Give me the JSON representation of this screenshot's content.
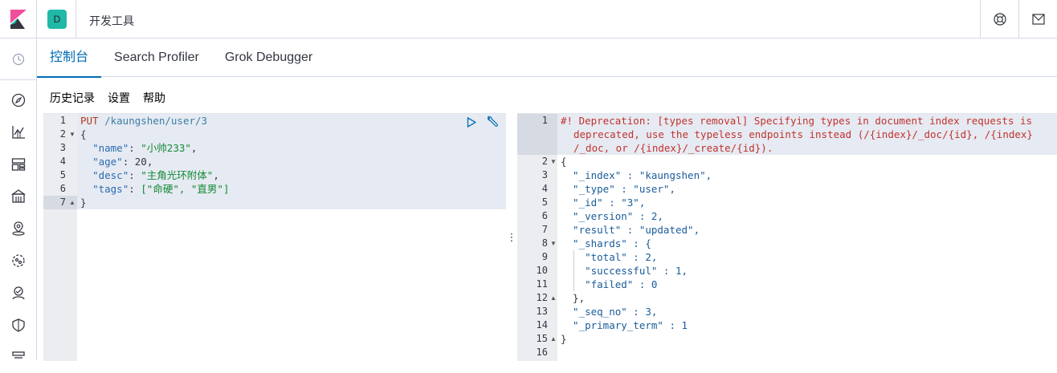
{
  "header": {
    "space_initial": "D",
    "app_title": "开发工具"
  },
  "icons": {
    "logo": "kibana-logo-icon",
    "help": "help-lifebuoy-icon",
    "mail": "mail-icon",
    "recent": "clock-icon",
    "nav": [
      "compass-icon",
      "visualize-icon",
      "dashboard-icon",
      "canvas-icon",
      "maps-icon",
      "ml-icon",
      "apm-icon",
      "siem-icon",
      "logs-icon"
    ]
  },
  "tabs": [
    {
      "label": "控制台",
      "active": true
    },
    {
      "label": "Search Profiler",
      "active": false
    },
    {
      "label": "Grok Debugger",
      "active": false
    }
  ],
  "submenu": {
    "history": "历史记录",
    "settings": "设置",
    "help": "帮助"
  },
  "request": {
    "line_numbers": [
      "1",
      "2",
      "3",
      "4",
      "5",
      "6",
      "7"
    ],
    "method": "PUT",
    "url": "/kaungshen/user/3",
    "lines": [
      {
        "key": "\"name\"",
        "val": "\"小帅233\"",
        "trail": ","
      },
      {
        "key": "\"age\"",
        "val": "20",
        "trail": ","
      },
      {
        "key": "\"desc\"",
        "val": "\"主角光环附体\"",
        "trail": ","
      },
      {
        "key": "\"tags\"",
        "val": "[\"命硬\", \"直男\"]",
        "trail": ""
      }
    ],
    "open_brace": "{",
    "close_brace": "}"
  },
  "response": {
    "line_numbers": [
      "1",
      "2",
      "3",
      "4",
      "5",
      "6",
      "7",
      "8",
      "9",
      "10",
      "11",
      "12",
      "13",
      "14",
      "15",
      "16"
    ],
    "warning": [
      "#! Deprecation: [types removal] Specifying types in document index requests is",
      "deprecated, use the typeless endpoints instead (/{index}/_doc/{id}, /{index}",
      "/_doc, or /{index}/_create/{id})."
    ],
    "body": [
      "{",
      "  \"_index\" : \"kaungshen\",",
      "  \"_type\" : \"user\",",
      "  \"_id\" : \"3\",",
      "  \"_version\" : 2,",
      "  \"result\" : \"updated\",",
      "  \"_shards\" : {",
      "    \"total\" : 2,",
      "    \"successful\" : 1,",
      "    \"failed\" : 0",
      "  },",
      "  \"_seq_no\" : 3,",
      "  \"_primary_term\" : 1",
      "}"
    ]
  }
}
